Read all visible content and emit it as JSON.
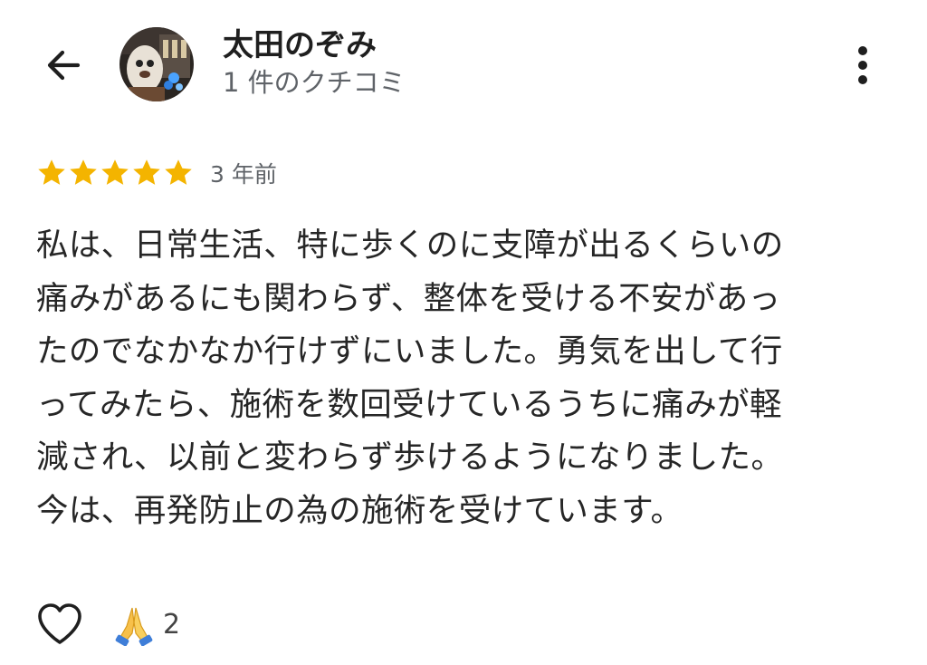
{
  "header": {
    "back_icon": "arrow-left-icon",
    "user_name": "太田のぞみ",
    "review_count": "1 件のクチコミ",
    "more_icon": "more-vertical-icon"
  },
  "review": {
    "rating": 5,
    "max_rating": 5,
    "star_color": "#f4b400",
    "date": "3 年前",
    "lines": [
      "私は、日常生活、特に歩くのに支障が出るくらいの",
      "痛みがあるにも関わらず、整体を受ける不安があっ",
      "たのでなかなか行けずにいました。勇気を出して行",
      "ってみたら、施術を数回受けているうちに痛みが軽",
      "減され、以前と変わらず歩けるようになりました。",
      "今は、再発防止の為の施術を受けています。"
    ]
  },
  "actions": {
    "like_icon": "heart-outline-icon",
    "reaction_icon": "folded-hands-icon",
    "reaction_count": "2"
  }
}
